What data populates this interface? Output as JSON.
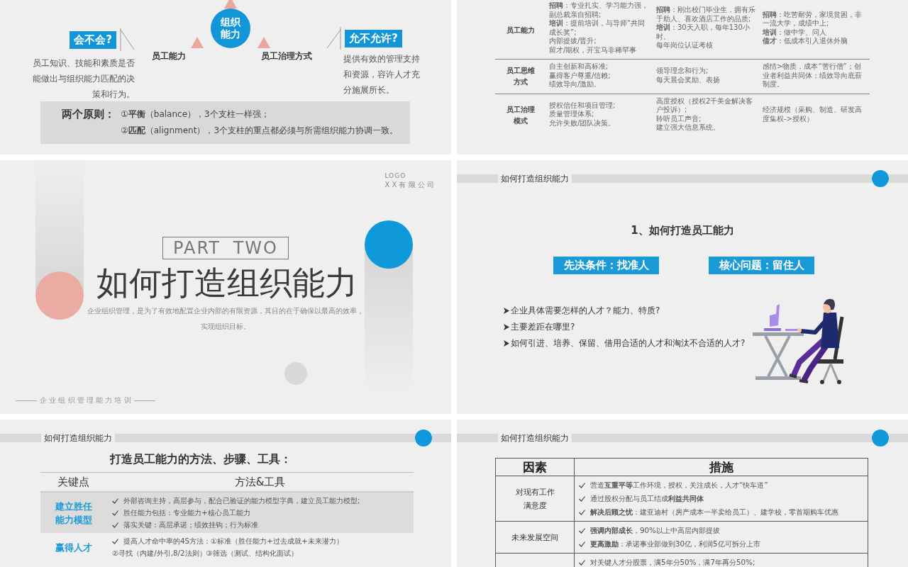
{
  "slides": [
    {
      "kind": "pillars",
      "left_label": "会不会?",
      "left_text": "员工知识、技能和素质是否能做出与组织能力匹配的决策和行为。",
      "center": "组织能力",
      "left_pillar": "员工能力",
      "right_pillar": "员工治理方式",
      "right_label": "允不允许?",
      "right_text": "提供有效的管理支持和资源，容许人才充分施展所长。",
      "principles_title": "两个原则：",
      "principles": [
        "①**平衡**（balance），3个支柱一样强；",
        "②**匹配**（alignment），3个支柱的重点都必须与所需组织能力协调一致。"
      ]
    },
    {
      "kind": "comparison",
      "rows": [
        {
          "header": "员工能力",
          "cells": [
            [
              "**招聘**：专业扎实、学习能力强，副总裁亲自招聘;",
              "**培训**：提前培训，与导师“共同成长奖”;",
              "内部提拔/晋升;",
              "留才/期权，开宝马非稀罕事"
            ],
            [
              "**招聘**：刚出校门毕业生，拥有乐于助人、喜欢酒店工作的品质;",
              "**培训**：30天入职，每年130小时。",
              "每年岗位认证考核"
            ],
            [
              "**招聘**：吃苦耐劳，家境贫困，非一流大学，成绩中上;",
              "**培训**：做中学、问人",
              "**借才**：低成本引入退休外脑"
            ]
          ]
        },
        {
          "header": "员工思维方式",
          "cells": [
            [
              "自主创新和高标准;",
              "赢得客户尊重/信赖;",
              "绩效导向/激励。"
            ],
            [
              "领导理念和行为;",
              "每天晨会奖励、表扬"
            ],
            [
              "感情>物质，成本“苦行僧”；创业者利益共同体；绩效导向底薪制度。"
            ]
          ]
        },
        {
          "header": "员工治理模式",
          "cells": [
            [
              "授权信任和项目管理;",
              "质量管理体系;",
              "允许失败/团队决策。"
            ],
            [
              "高度授权（授权2千美金解决客户投诉）;",
              "聆听员工声音;",
              "建立强大信息系统。"
            ],
            [
              "经济规模（采购、制造、研发高度集权->授权）"
            ]
          ]
        }
      ]
    },
    {
      "kind": "section",
      "logo": "LOGO",
      "company": "X X 有 限 公 司",
      "part": "PART TWO",
      "title": "如何打造组织能力",
      "subtitle": "企业组织管理，是为了有效地配置企业内部的有限资源，其目的在于确保以最高的效率，实现组织目标。",
      "footer": "企 业 组 织 管 理 能 力 培 训"
    },
    {
      "kind": "intro",
      "header": "如何打造组织能力",
      "title": "1、如何打造员工能力",
      "tags": [
        "先决条件：找准人",
        "核心问题：留住人"
      ],
      "bullets": [
        "企业具体需要怎样的人才？能力、特质?",
        "主要差距在哪里?",
        "如何引进、培养、保留、借用合适的人才和淘汰不合适的人才?"
      ]
    },
    {
      "kind": "methods",
      "header": "如何打造组织能力",
      "title": "打造员工能力的方法、步骤、工具：",
      "columns": [
        "关键点",
        "方法&工具"
      ],
      "rows": [
        {
          "key": [
            "建立胜任",
            "能力模型"
          ],
          "shaded": true,
          "items": [
            {
              "kind": "check",
              "text": "外部咨询主持，高层参与，配合已验证的能力模型字典，建立员工能力模型;"
            },
            {
              "kind": "check",
              "text": "胜任能力包括：专业能力+核心员工能力"
            },
            {
              "kind": "check",
              "text": "落实关键：高层承诺；绩效挂钩；行为标准"
            }
          ]
        },
        {
          "key": [
            "赢得人才"
          ],
          "shaded": false,
          "items": [
            {
              "kind": "check",
              "text": "提高人才命中率的4S方法：①标准（胜任能力+过去成就+未来潜力）"
            },
            {
              "kind": "continuation",
              "text": "②寻找（内建/外引,8/2法则）③筛选（测试、结构化面试）"
            }
          ]
        }
      ]
    },
    {
      "kind": "retention",
      "header": "如何打造组织能力",
      "columns": [
        "因素",
        "措施"
      ],
      "rows": [
        {
          "factor": [
            "对现有工作",
            "满意度"
          ],
          "measures": [
            "营造**互重平等**工作环境，授权，关注成长，人才“快车道”",
            "通过股权分配与员工结成**利益共同体**",
            "**解决后顾之忧**：建亚迪村（房产成本一半卖给员工）、建学校，零首期购车优惠"
          ]
        },
        {
          "factor": [
            "未来发展空间"
          ],
          "measures": [
            "**强调内部成长**，90%以上中高层内部提拔",
            "**更高激励**：承诺事业部做到30亿，利润5亿可拆分上市"
          ]
        },
        {
          "measures": [
            "对关键人才分股票，满5年分50%，满7年再分50%;"
          ]
        }
      ]
    }
  ]
}
